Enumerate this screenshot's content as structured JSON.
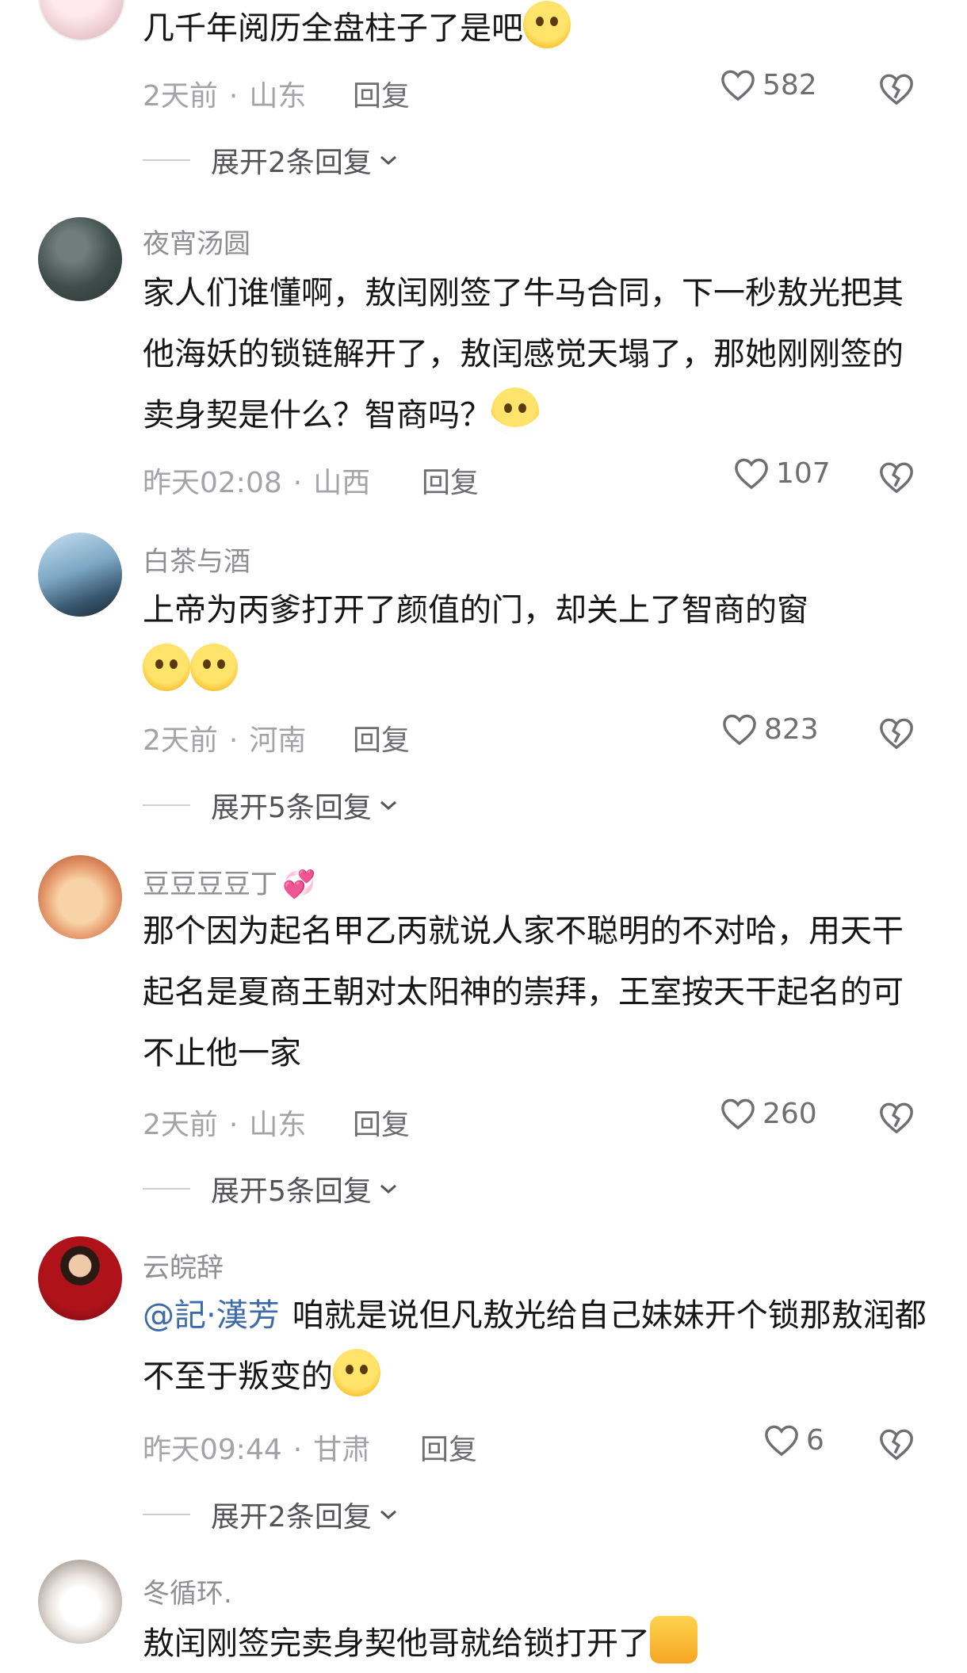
{
  "comments": [
    {
      "username": "",
      "text": "几千年阅历全盘柱子了是吧",
      "meta": {
        "time": "2天前",
        "location": "山东"
      },
      "reply_label": "回复",
      "likes": "582",
      "expand_label": "展开2条回复"
    },
    {
      "username": "夜宵汤圆",
      "text": "家人们谁懂啊，敖闰刚签了牛马合同，下一秒敖光把其他海妖的锁链解开了，敖闰感觉天塌了，那她刚刚签的卖身契是什么？智商吗？",
      "meta": {
        "time": "昨天02:08",
        "location": "山西"
      },
      "reply_label": "回复",
      "likes": "107"
    },
    {
      "username": "白茶与酒",
      "text": "上帝为丙爹打开了颜值的门，却关上了智商的窗",
      "meta": {
        "time": "2天前",
        "location": "河南"
      },
      "reply_label": "回复",
      "likes": "823",
      "expand_label": "展开5条回复"
    },
    {
      "username": "豆豆豆豆丁",
      "text": "那个因为起名甲乙丙就说人家不聪明的不对哈，用天干起名是夏商王朝对太阳神的崇拜，王室按天干起名的可不止他一家",
      "meta": {
        "time": "2天前",
        "location": "山东"
      },
      "reply_label": "回复",
      "likes": "260",
      "expand_label": "展开5条回复"
    },
    {
      "username": "云皖辞",
      "mention": "@記·漢芳",
      "text": "咱就是说但凡敖光给自己妹妹开个锁那敖润都不至于叛变的",
      "meta": {
        "time": "昨天09:44",
        "location": "甘肃"
      },
      "reply_label": "回复",
      "likes": "6",
      "expand_label": "展开2条回复"
    },
    {
      "username": "冬循环.",
      "text": "敖闰刚签完卖身契他哥就给锁打开了"
    }
  ],
  "meta_separator": "·",
  "icons": {
    "like": "heart-outline-icon",
    "dislike": "broken-heart-icon",
    "expand": "chevron-down-icon"
  }
}
